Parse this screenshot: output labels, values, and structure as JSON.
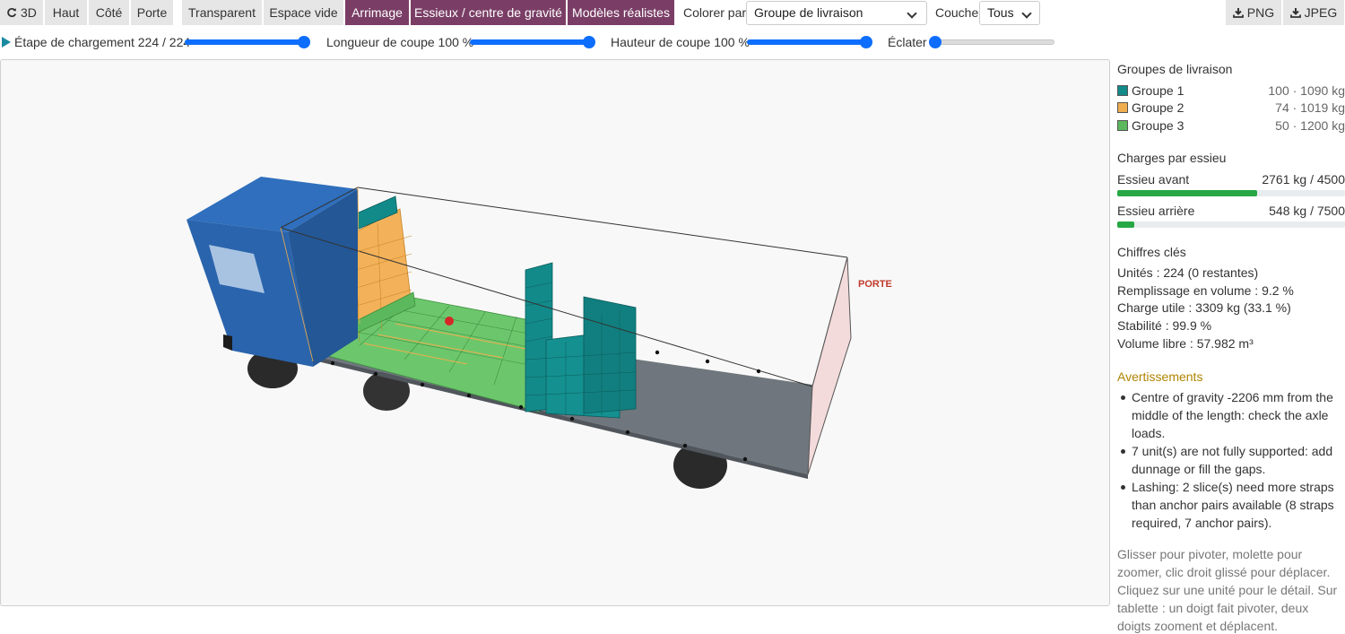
{
  "toolbar": {
    "view_buttons": [
      "3D",
      "Haut",
      "Côté",
      "Porte"
    ],
    "mode_buttons": [
      "Transparent",
      "Espace vide",
      "Arrimage",
      "Essieux / centre de gravité",
      "Modèles réalistes"
    ],
    "color_by_label": "Colorer par",
    "color_by_value": "Groupe de livraison",
    "layer_label": "Couche",
    "layer_value": "Tous",
    "export_png": "PNG",
    "export_jpeg": "JPEG"
  },
  "sliders": {
    "step_label": "Étape de chargement 224 / 224",
    "step_value": 1.0,
    "cut_length_label": "Longueur de coupe 100 %",
    "cut_length_value": 1.0,
    "cut_height_label": "Hauteur de coupe 100 %",
    "cut_height_value": 1.0,
    "explode_label": "Éclater",
    "explode_value": 0.0
  },
  "viewport": {
    "door_label": "PORTE"
  },
  "panel": {
    "groups_title": "Groupes de livraison",
    "groups": [
      {
        "name": "Groupe 1",
        "value": "100 · 1090 kg",
        "color": "#138a8a"
      },
      {
        "name": "Groupe 2",
        "value": "74 · 1019 kg",
        "color": "#f0ad4e"
      },
      {
        "name": "Groupe 3",
        "value": "50 · 1200 kg",
        "color": "#5cb85c"
      }
    ],
    "axles_title": "Charges par essieu",
    "axles": [
      {
        "name": "Essieu avant",
        "value": "2761 kg / 4500",
        "ratio": 0.614
      },
      {
        "name": "Essieu arrière",
        "value": "548 kg / 7500",
        "ratio": 0.073
      }
    ],
    "key_figures_title": "Chiffres clés",
    "key_figures": [
      "Unités : 224 (0 restantes)",
      "Remplissage en volume : 9.2 %",
      "Charge utile : 3309 kg (33.1 %)",
      "Stabilité : 99.9 %",
      "Volume libre : 57.982 m³"
    ],
    "warnings_title": "Avertissements",
    "warnings": [
      "Centre of gravity -2206 mm from the middle of the length: check the axle loads.",
      "7 unit(s) are not fully supported: add dunnage or fill the gaps.",
      "Lashing: 2 slice(s) need more straps than anchor pairs available (8 straps required, 7 anchor pairs)."
    ],
    "help_text": "Glisser pour pivoter, molette pour zoomer, clic droit glissé pour déplacer. Cliquez sur une unité pour le détail. Sur tablette : un doigt fait pivoter, deux doigts zooment et déplacent."
  },
  "colors": {
    "accent": "#7a3e66",
    "slider": "#0d6efd",
    "group1": "#138a8a",
    "group2": "#f0ad4e",
    "group3": "#5cb85c",
    "axle_fill": "#28a745",
    "warning": "#b08400",
    "cab": "#2a64ad"
  },
  "icons": {
    "view_3d": "rotate-icon",
    "export": "download-icon",
    "play": "play-icon",
    "dropdown": "chevron-down-icon"
  }
}
